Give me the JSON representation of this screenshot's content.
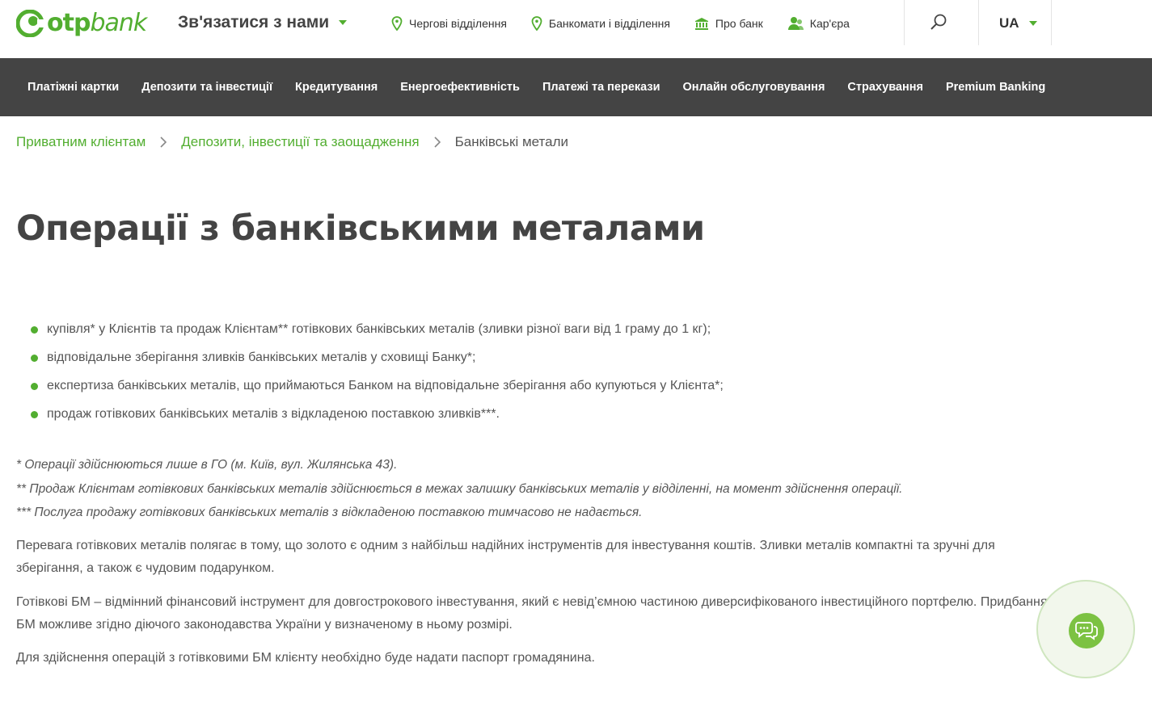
{
  "brand": {
    "logo_text_bold": "otp",
    "logo_text_rest": "bank",
    "color": "#52ae30"
  },
  "header": {
    "contact_label": "Зв'язатися з нами",
    "links": [
      {
        "label": "Чергові відділення",
        "icon": "location-pin-icon"
      },
      {
        "label": "Банкомати і відділення",
        "icon": "location-pin-icon"
      },
      {
        "label": "Про банк",
        "icon": "bank-building-icon"
      },
      {
        "label": "Кар'єра",
        "icon": "career-people-icon"
      }
    ],
    "search_icon": "search-icon",
    "language": "UA"
  },
  "nav": {
    "items": [
      "Платіжні картки",
      "Депозити та інвестиції",
      "Кредитування",
      "Енергоефективність",
      "Платежі та перекази",
      "Онлайн обслуговування",
      "Страхування",
      "Premium Banking"
    ]
  },
  "breadcrumb": {
    "items": [
      "Приватним клієнтам",
      "Депозити, інвестиції та заощадження"
    ],
    "current": "Банківські метали"
  },
  "page": {
    "title": "Операції з банківськими металами",
    "bullets": [
      "купівля* у Клієнтів та продаж Клієнтам** готівкових банківських металів (зливки різної ваги від 1 граму до 1 кг);",
      "відповідальне зберігання зливків банківських металів у сховищі Банку*;",
      "експертиза банківських металів, що приймаються Банком на відповідальне зберігання або купуються у Клієнта*;",
      "продаж готівкових банківських металів з відкладеною поставкою зливків***."
    ],
    "notes": [
      "* Операції здійснюються лише в ГО (м. Київ, вул. Жилянська 43).",
      "** Продаж Клієнтам готівкових банківських металів здійснюється в межах залишку банківських металів у відділенні, на момент здійснення операції.",
      "*** Послуга продажу готівкових банківських металів з відкладеною поставкою тимчасово не надається."
    ],
    "paragraphs": [
      "Перевага готівкових металів полягає в тому, що золото є одним з найбільш надійних інструментів для інвестування коштів. Зливки металів компактні та зручні для зберігання, а також є чудовим подарунком.",
      "Готівкові БМ – відмінний фінансовий інструмент для довгострокового інвестування, який є невід’ємною частиною диверсифікованого інвестиційного портфелю. Придбання БМ можливе згідно діючого законодавства України у визначеному в ньому розмірі.",
      "Для здійснення операцій з готівковими БМ клієнту необхідно буде надати паспорт громадянина."
    ]
  },
  "chat": {
    "icon": "chat-bubbles-icon",
    "accent": "#7cc242"
  }
}
